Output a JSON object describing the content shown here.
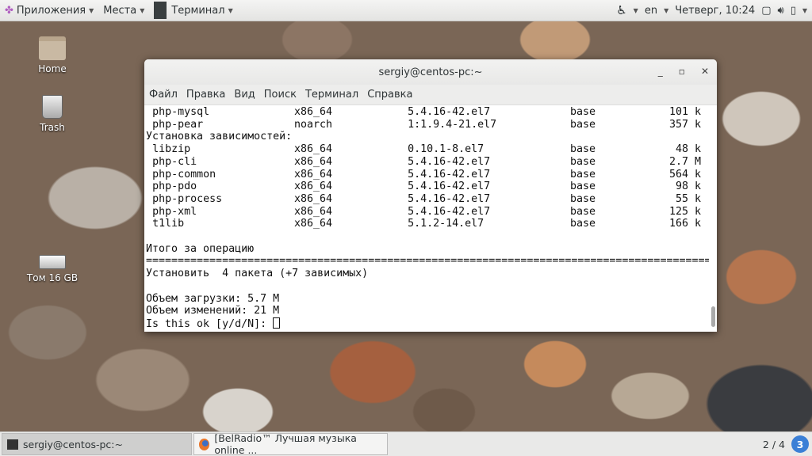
{
  "topbar": {
    "applications": "Приложения",
    "places": "Места",
    "active_app": "Терминал",
    "language": "en",
    "clock": "Четверг, 10:24"
  },
  "desktop": {
    "icons": [
      {
        "label": "Home"
      },
      {
        "label": "Trash"
      },
      {
        "label": "Том 16 GB"
      }
    ]
  },
  "window": {
    "title": "sergiy@centos-pc:~",
    "menu": [
      "Файл",
      "Правка",
      "Вид",
      "Поиск",
      "Терминал",
      "Справка"
    ]
  },
  "terminal": {
    "packages_top": [
      {
        "name": "php-mysql",
        "arch": "x86_64",
        "version": "5.4.16-42.el7",
        "repo": "base",
        "size": "101 k"
      },
      {
        "name": "php-pear",
        "arch": "noarch",
        "version": "1:1.9.4-21.el7",
        "repo": "base",
        "size": "357 k"
      }
    ],
    "deps_header": "Установка зависимостей:",
    "deps": [
      {
        "name": "libzip",
        "arch": "x86_64",
        "version": "0.10.1-8.el7",
        "repo": "base",
        "size": "48 k"
      },
      {
        "name": "php-cli",
        "arch": "x86_64",
        "version": "5.4.16-42.el7",
        "repo": "base",
        "size": "2.7 M"
      },
      {
        "name": "php-common",
        "arch": "x86_64",
        "version": "5.4.16-42.el7",
        "repo": "base",
        "size": "564 k"
      },
      {
        "name": "php-pdo",
        "arch": "x86_64",
        "version": "5.4.16-42.el7",
        "repo": "base",
        "size": "98 k"
      },
      {
        "name": "php-process",
        "arch": "x86_64",
        "version": "5.4.16-42.el7",
        "repo": "base",
        "size": "55 k"
      },
      {
        "name": "php-xml",
        "arch": "x86_64",
        "version": "5.4.16-42.el7",
        "repo": "base",
        "size": "125 k"
      },
      {
        "name": "t1lib",
        "arch": "x86_64",
        "version": "5.1.2-14.el7",
        "repo": "base",
        "size": "166 k"
      }
    ],
    "summary_header": "Итого за операцию",
    "separator": "=========================================================================================",
    "install_line": "Установить  4 пакета (+7 зависимых)",
    "download_size": "Объем загрузки: 5.7 M",
    "change_size": "Объем изменений: 21 M",
    "prompt": "Is this ok [y/d/N]: "
  },
  "taskbar": {
    "tasks": [
      {
        "label": "sergiy@centos-pc:~"
      },
      {
        "label": "[BelRadio™ Лучшая музыка online ..."
      }
    ],
    "workspace": "2 / 4",
    "notifications": "3"
  }
}
